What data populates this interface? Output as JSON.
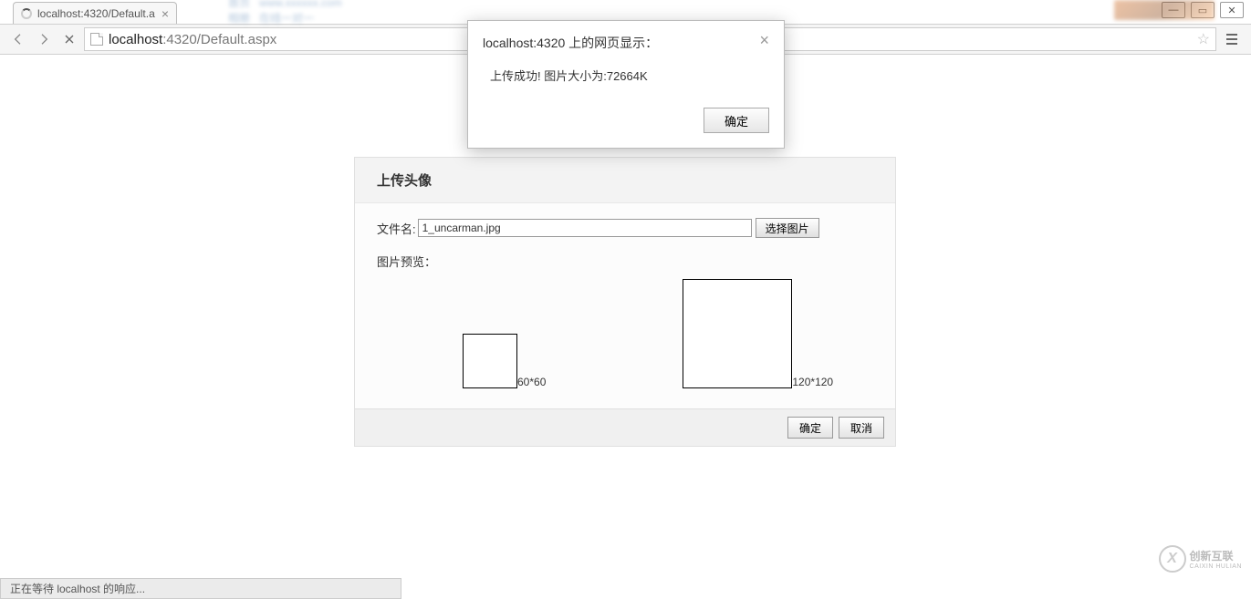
{
  "window_controls": {
    "min": "—",
    "max": "▭",
    "close": "✕"
  },
  "tab": {
    "title": "localhost:4320/Default.a"
  },
  "bg_blur": {
    "line1a": "首页",
    "line1b": "www.xxxxxx.com",
    "line2a": "相册",
    "line2b": "在线一对一"
  },
  "url": {
    "host": "localhost",
    "rest": ":4320/Default.aspx"
  },
  "alert": {
    "title": "localhost:4320 上的网页显示：",
    "message": "上传成功! 图片大小为:72664K",
    "ok": "确定"
  },
  "panel": {
    "title": "上传头像",
    "filename_label": "文件名:",
    "filename_value": "1_uncarman.jpg",
    "choose_btn": "选择图片",
    "preview_label": "图片预览：",
    "size60": "60*60",
    "size120": "120*120",
    "ok": "确定",
    "cancel": "取消"
  },
  "status": "正在等待 localhost 的响应...",
  "watermark": {
    "text": "创新互联",
    "sub": "CAIXIN HULIAN"
  }
}
